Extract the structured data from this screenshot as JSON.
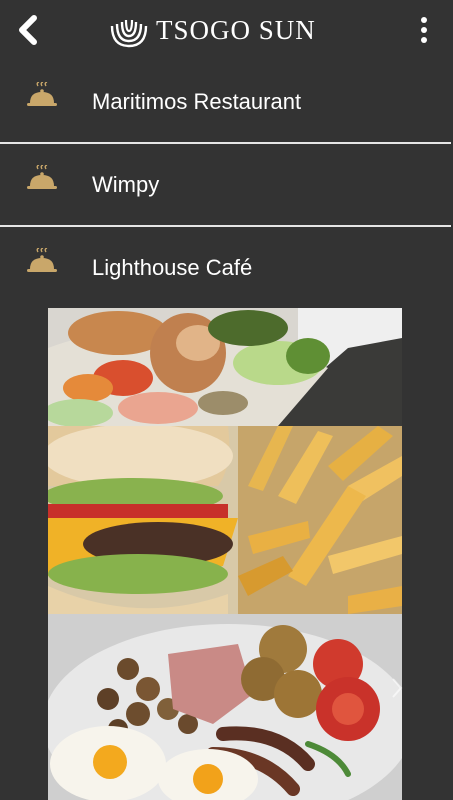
{
  "header": {
    "brand": "TSOGO SUN"
  },
  "restaurants": [
    {
      "label": "Maritimos Restaurant",
      "icon": "food-cloche-icon"
    },
    {
      "label": "Wimpy",
      "icon": "food-cloche-icon"
    },
    {
      "label": "Lighthouse Café",
      "icon": "food-cloche-icon"
    }
  ],
  "icons": {
    "back": "chevron-left-icon",
    "menu": "more-vertical-icon",
    "logo": "tsogo-sun-swirl-logo",
    "next": "chevron-right-icon"
  },
  "colors": {
    "background": "#333333",
    "text": "#ffffff",
    "divider": "#e6e6e6",
    "icon_gold": "#c9a76a"
  }
}
